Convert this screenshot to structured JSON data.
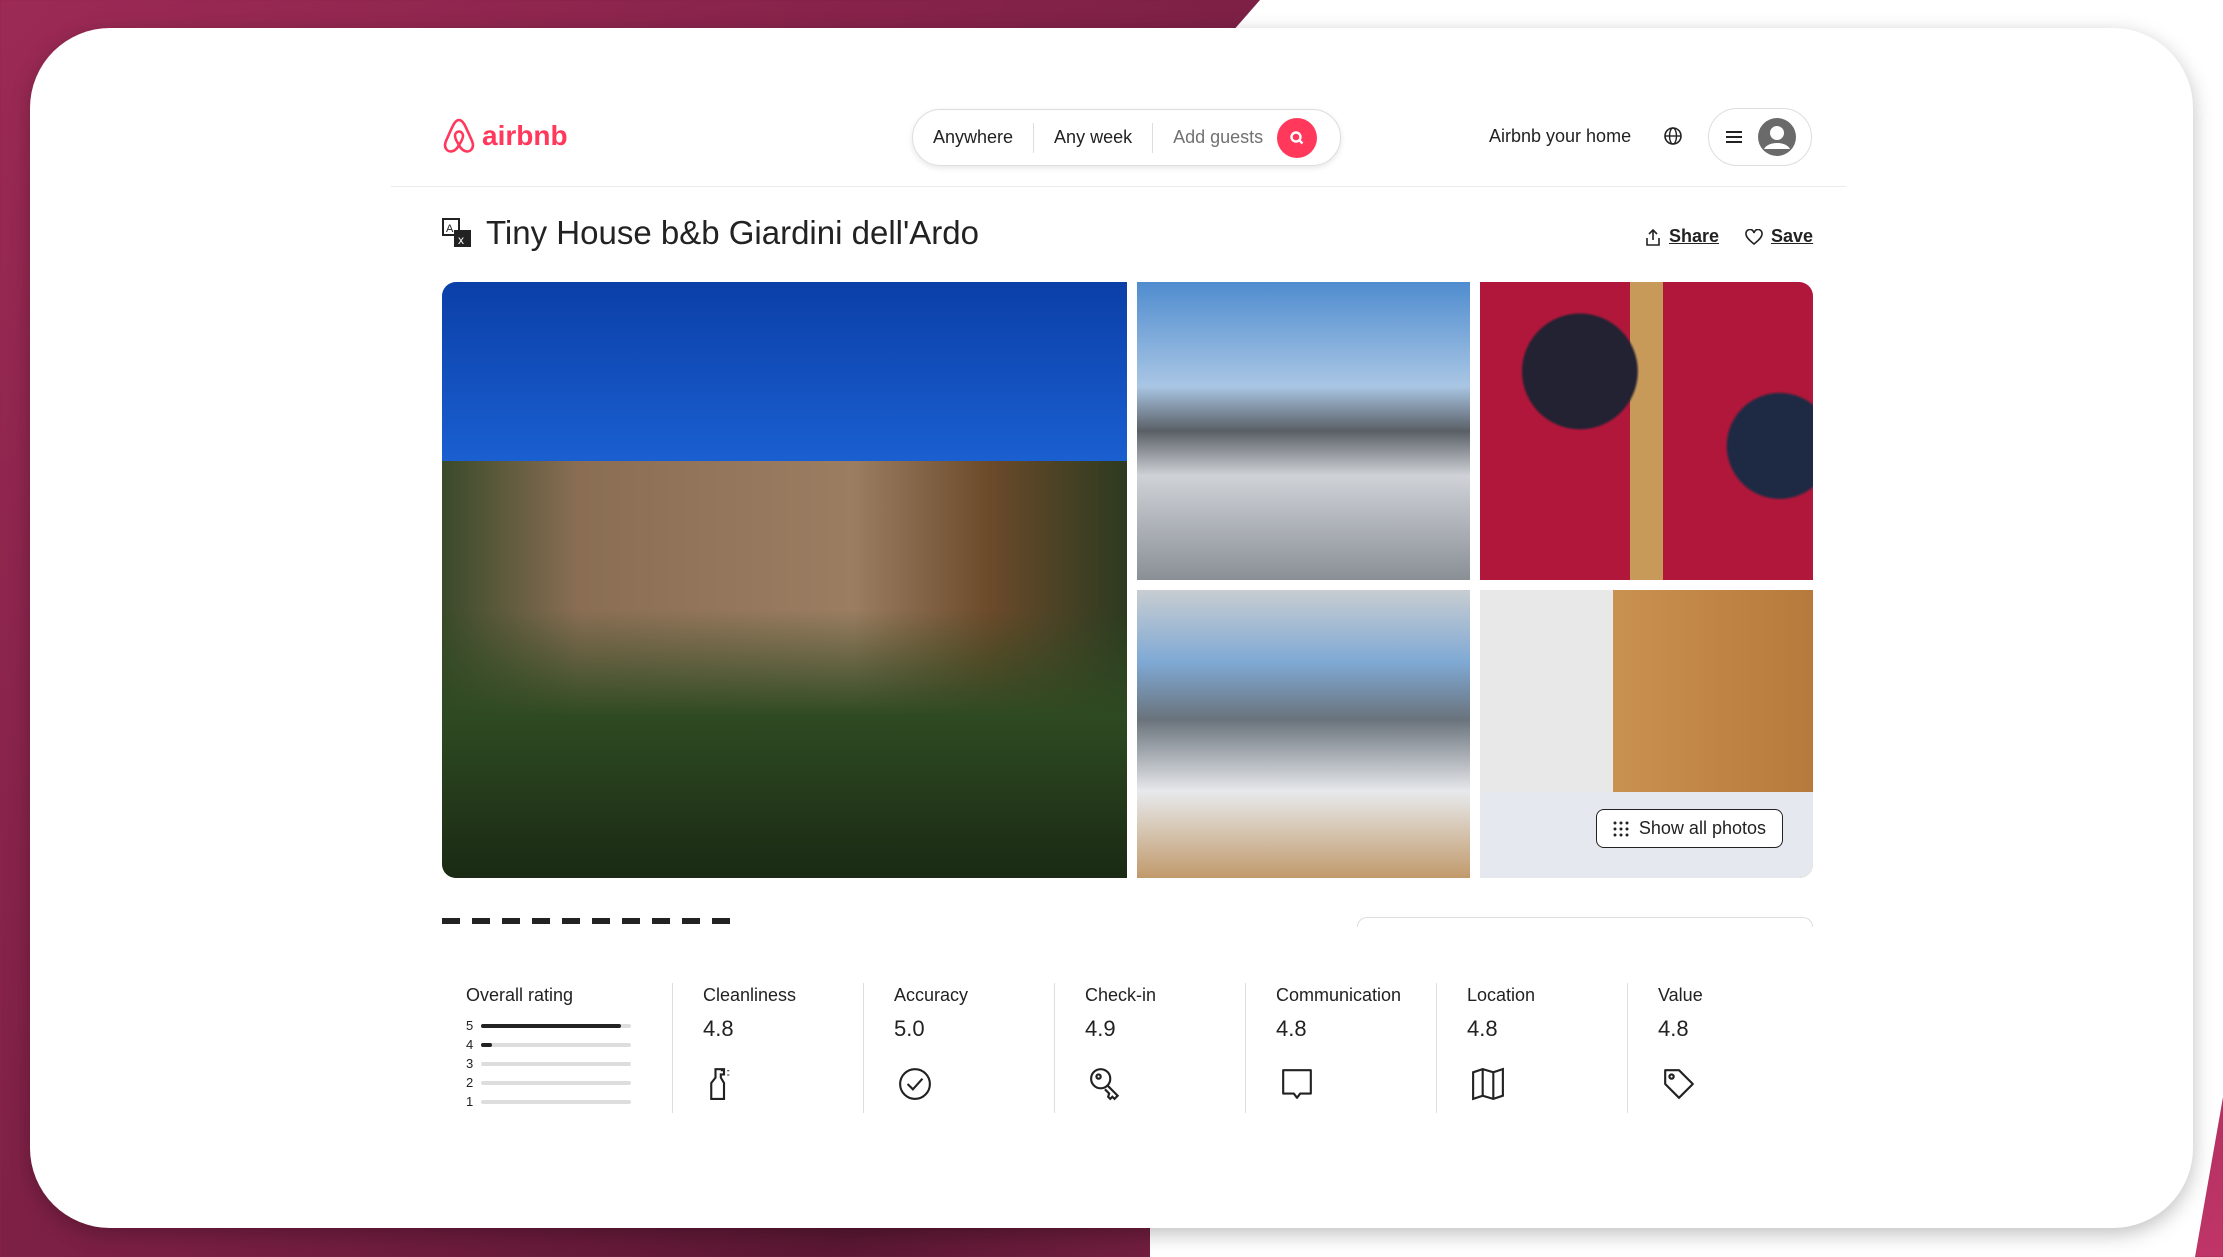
{
  "header": {
    "logo": "airbnb",
    "search": {
      "where": "Anywhere",
      "when": "Any week",
      "guests": "Add guests"
    },
    "host_link": "Airbnb your home",
    "brand_color": "#ff385c"
  },
  "listing": {
    "title": "Tiny House b&b Giardini dell'Ardo",
    "share": "Share",
    "save": "Save",
    "show_all_photos": "Show all photos"
  },
  "ratings": {
    "overall_label": "Overall rating",
    "distribution": [
      {
        "stars": "5",
        "fraction": 0.93
      },
      {
        "stars": "4",
        "fraction": 0.07
      },
      {
        "stars": "3",
        "fraction": 0
      },
      {
        "stars": "2",
        "fraction": 0
      },
      {
        "stars": "1",
        "fraction": 0
      }
    ],
    "categories": [
      {
        "label": "Cleanliness",
        "value": "4.8",
        "icon": "spray-bottle-icon"
      },
      {
        "label": "Accuracy",
        "value": "5.0",
        "icon": "check-circle-icon"
      },
      {
        "label": "Check-in",
        "value": "4.9",
        "icon": "key-icon"
      },
      {
        "label": "Communication",
        "value": "4.8",
        "icon": "chat-bubble-icon"
      },
      {
        "label": "Location",
        "value": "4.8",
        "icon": "map-icon"
      },
      {
        "label": "Value",
        "value": "4.8",
        "icon": "tag-icon"
      }
    ]
  }
}
